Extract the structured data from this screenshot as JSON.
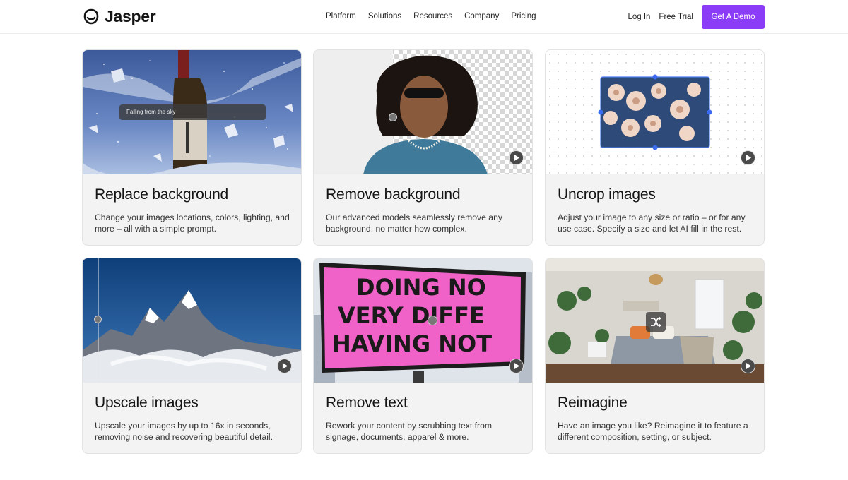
{
  "header": {
    "brand": "Jasper",
    "links": [
      "Platform",
      "Solutions",
      "Resources",
      "Company",
      "Pricing"
    ],
    "login": "Log In",
    "trial": "Free Trial",
    "demo": "Get A Demo",
    "accent_color": "#8b3cf7"
  },
  "cards": [
    {
      "title": "Replace background",
      "description": "Change your images locations, colors, lighting, and more – all with a simple prompt.",
      "prompt_text": "Falling from the sky"
    },
    {
      "title": "Remove background",
      "description": "Our advanced models seamlessly remove any background, no matter how complex."
    },
    {
      "title": "Uncrop images",
      "description": "Adjust your image to any size or ratio – or for any use case. Specify a size and let AI fill in the rest."
    },
    {
      "title": "Upscale images",
      "description": "Upscale your images by up to 16x in seconds, removing noise and recovering beautiful detail."
    },
    {
      "title": "Remove text",
      "description": "Rework your content by scrubbing text from signage, documents, apparel & more.",
      "billboard_lines": [
        "DOING NO",
        "VERY DIFFE",
        "HAVING NOT"
      ]
    },
    {
      "title": "Reimagine",
      "description": "Have an image you like? Reimagine it to feature a different composition, setting, or subject."
    }
  ],
  "icons": {
    "play": "play-icon",
    "shuffle": "shuffle-icon",
    "logo": "jasper-logo-icon"
  }
}
